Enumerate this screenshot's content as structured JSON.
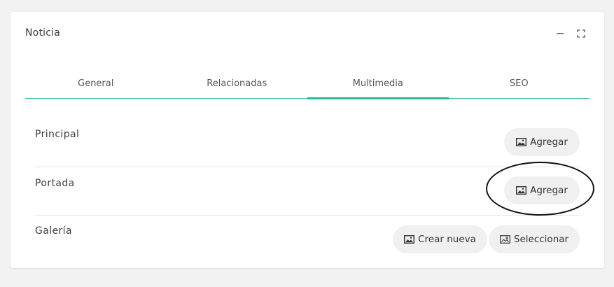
{
  "card": {
    "title": "Noticia",
    "minimize_icon": "minimize-icon",
    "expand_icon": "expand-icon"
  },
  "tabs": [
    {
      "label": "General",
      "active": false
    },
    {
      "label": "Relacionadas",
      "active": false
    },
    {
      "label": "Multimedia",
      "active": true
    },
    {
      "label": "SEO",
      "active": false
    }
  ],
  "sections": {
    "principal": {
      "label": "Principal",
      "add_label": "Agregar"
    },
    "portada": {
      "label": "Portada",
      "add_label": "Agregar"
    },
    "galeria": {
      "label": "Galería",
      "create_label": "Crear nueva",
      "select_label": "Seleccionar"
    }
  },
  "colors": {
    "accent": "#2bb894",
    "background": "#f2f2f2",
    "button_bg": "#f0f0f0"
  }
}
